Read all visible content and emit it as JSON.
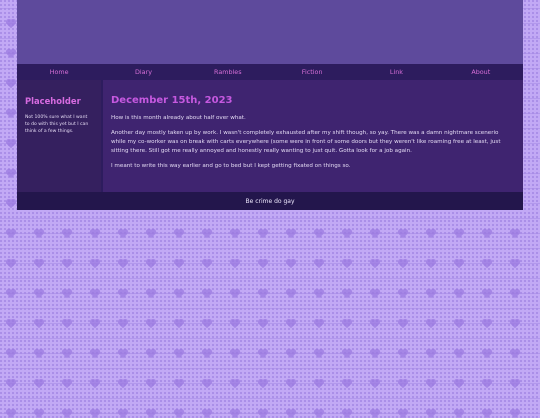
{
  "nav": {
    "items": [
      {
        "label": "Home"
      },
      {
        "label": "Diary"
      },
      {
        "label": "Rambles"
      },
      {
        "label": "Fiction"
      },
      {
        "label": "Link"
      },
      {
        "label": "About"
      }
    ]
  },
  "sidebar": {
    "title": "Placeholder",
    "text": "Not 100% sure what I want to do with this yet but I can think of a few things."
  },
  "entry": {
    "date": "December 15th, 2023",
    "paragraphs": [
      "How is this month already about half over what.",
      "Another day mostly taken up by work. I wasn't completely exhausted after my shift though, so yay. There was a damn nightmare scenerio while my co-worker was on break with carts everywhere (some were in front of some doors but they weren't like roaming free at least, just sitting there. Still got me really annoyed and honestly really wanting to just quit. Gotta look for a job again.",
      "I meant to write this way earlier and go to bed but I kept getting fixated on things so."
    ]
  },
  "footer": {
    "text": "Be crime do gay"
  },
  "colors": {
    "page_bg": "#c2a9f5",
    "banner": "#5e4a9c",
    "nav_bg": "#2d1c5e",
    "nav_link": "#d56ed6",
    "heading": "#c659e0",
    "main_bg": "#3f2470",
    "footer_bg": "#23164c"
  }
}
